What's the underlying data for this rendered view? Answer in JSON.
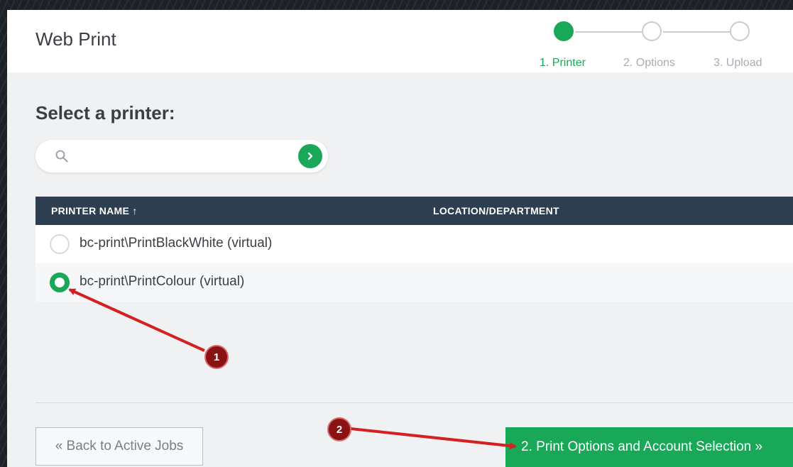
{
  "header": {
    "title": "Web Print",
    "steps": [
      {
        "label": "1. Printer",
        "active": true
      },
      {
        "label": "2. Options",
        "active": false
      },
      {
        "label": "3. Upload",
        "active": false
      }
    ]
  },
  "main": {
    "section_title": "Select a printer:",
    "search": {
      "placeholder": "",
      "value": ""
    },
    "table": {
      "columns": [
        "PRINTER NAME ↑",
        "LOCATION/DEPARTMENT"
      ],
      "rows": [
        {
          "name": "bc-print\\PrintBlackWhite (virtual)",
          "location": "",
          "selected": false
        },
        {
          "name": "bc-print\\PrintColour (virtual)",
          "location": "",
          "selected": true
        }
      ]
    }
  },
  "footer": {
    "back_label": "« Back to Active Jobs",
    "next_label": "2. Print Options and Account Selection »"
  },
  "annotations": {
    "badges": [
      "1",
      "2"
    ],
    "color": "#d42020"
  },
  "colors": {
    "accent": "#19a857",
    "table_header": "#2c3e50"
  }
}
